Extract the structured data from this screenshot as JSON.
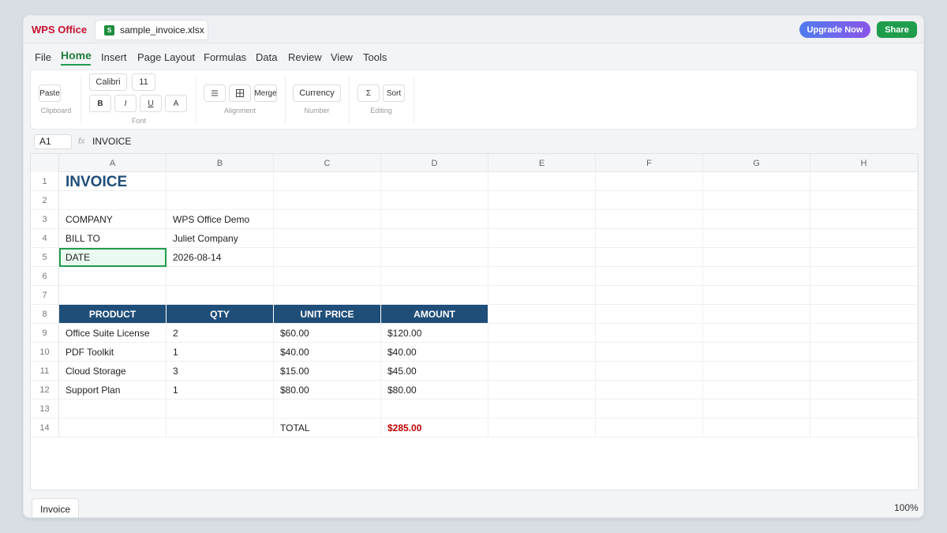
{
  "app": {
    "brand": "WPS Office",
    "file_tab": "sample_invoice.xlsx",
    "file_icon_letter": "S",
    "upgrade_label": "Upgrade Now",
    "share_label": "Share",
    "colors": {
      "brand_red": "#c8102e",
      "accent_green": "#1f9d4c",
      "header_blue": "#1f4e79",
      "total_red": "#c00000"
    }
  },
  "menu": [
    "File",
    "Home",
    "Insert",
    "Page Layout",
    "Formulas",
    "Data",
    "Review",
    "View",
    "Tools"
  ],
  "menu_active": "Home",
  "ribbon": {
    "paste": "Paste",
    "clipboard_label": "Clipboard",
    "font_name": "Calibri",
    "font_size": "11",
    "bold": "B",
    "italic": "I",
    "underline": "U",
    "font_color": "A",
    "font_label": "Font",
    "align_icon": "align-left-icon",
    "border_icon": "borders-icon",
    "merge": "Merge",
    "alignment_label": "Alignment",
    "number_format": "Currency",
    "number_label": "Number",
    "sum_icon": "sum-icon",
    "sort": "Sort",
    "editing_label": "Editing"
  },
  "formula_bar": {
    "cell_ref": "A1",
    "fx": "fx",
    "content": "INVOICE"
  },
  "grid": {
    "columns": [
      "A",
      "B",
      "C",
      "D",
      "E",
      "F",
      "G",
      "H"
    ],
    "rows": [
      {
        "num": "1",
        "cells": [
          "INVOICE",
          "",
          "",
          ""
        ]
      },
      {
        "num": "2",
        "cells": [
          "",
          "",
          "",
          ""
        ]
      },
      {
        "num": "3",
        "cells": [
          "COMPANY",
          "WPS Office Demo",
          "",
          ""
        ]
      },
      {
        "num": "4",
        "cells": [
          "BILL TO",
          "Juliet Company",
          "",
          ""
        ]
      },
      {
        "num": "5",
        "cells": [
          "DATE",
          "2026-08-14",
          "",
          ""
        ]
      },
      {
        "num": "6",
        "cells": [
          "",
          "",
          "",
          ""
        ]
      },
      {
        "num": "7",
        "cells": [
          "",
          "",
          "",
          ""
        ]
      },
      {
        "num": "8",
        "cells": [
          "PRODUCT",
          "QTY",
          "UNIT PRICE",
          "AMOUNT"
        ]
      },
      {
        "num": "9",
        "cells": [
          "Office Suite License",
          "2",
          "$60.00",
          "$120.00"
        ]
      },
      {
        "num": "10",
        "cells": [
          "PDF Toolkit",
          "1",
          "$40.00",
          "$40.00"
        ]
      },
      {
        "num": "11",
        "cells": [
          "Cloud Storage",
          "3",
          "$15.00",
          "$45.00"
        ]
      },
      {
        "num": "12",
        "cells": [
          "Support Plan",
          "1",
          "$80.00",
          "$80.00"
        ]
      },
      {
        "num": "13",
        "cells": [
          "",
          "",
          "",
          ""
        ]
      },
      {
        "num": "14",
        "cells": [
          "",
          "",
          "TOTAL",
          "$285.00"
        ]
      }
    ]
  },
  "sheet_tab": "Invoice",
  "zoom": "100%"
}
